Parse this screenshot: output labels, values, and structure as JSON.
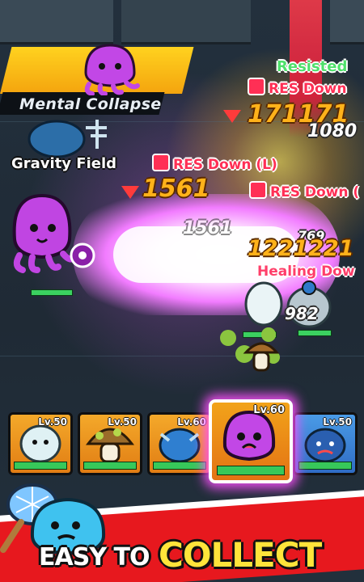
{
  "skill_banner": {
    "label": "Mental Collapse"
  },
  "effects": {
    "resisted": "Resisted",
    "res_down_1": "RES Down",
    "res_down_2": "RES Down (L)",
    "res_down_3": "RES Down (",
    "healing_down": "Healing Dow",
    "gravity_field": "Gravity Field"
  },
  "damage": {
    "d1": "171171",
    "d2": "1080",
    "d3": "1561",
    "d4": "1561",
    "d5": "1221221",
    "d6": "769",
    "d7": "982"
  },
  "heroes": [
    {
      "level": "Lv.50",
      "color": "#f0a323"
    },
    {
      "level": "Lv.50",
      "color": "#f0a323"
    },
    {
      "level": "Lv.60",
      "color": "#f0a323"
    },
    {
      "level": "Lv.60",
      "color": "#f0a323",
      "selected": true
    },
    {
      "level": "Lv.50",
      "color": "#3b86d8"
    }
  ],
  "tagline": {
    "easy": "EASY TO",
    "collect": "COLLECT"
  },
  "colors": {
    "accent_purple": "#d04cff",
    "debuff_red": "#ff2f55",
    "resist_green": "#4fe06b",
    "banner_yellow": "#ffd21f"
  }
}
